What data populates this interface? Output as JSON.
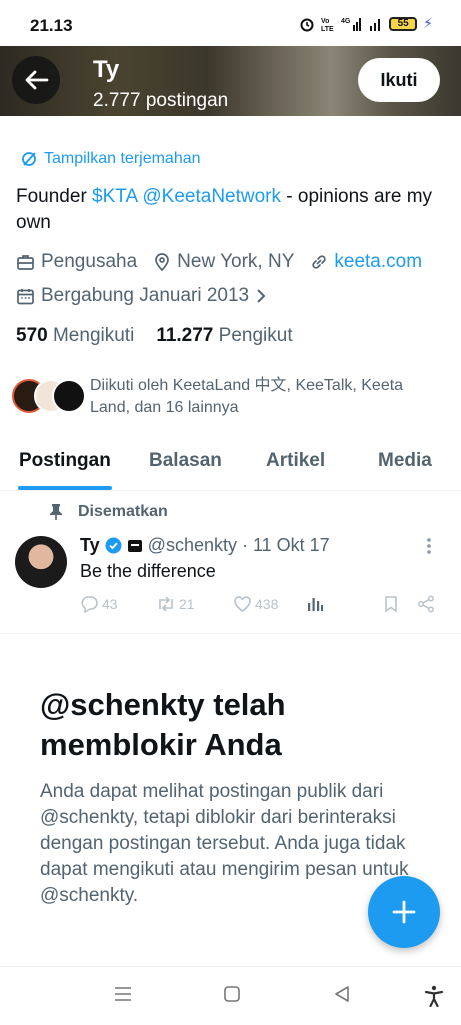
{
  "status_bar": {
    "time": "21.13",
    "battery": "55"
  },
  "header": {
    "name": "Ty",
    "post_count": "2.777 postingan",
    "follow_label": "Ikuti"
  },
  "profile": {
    "translate_label": "Tampilkan terjemahan",
    "bio_prefix": "Founder ",
    "bio_link1": "$KTA",
    "bio_link2": "@KeetaNetwork",
    "bio_suffix": " - opinions are my own",
    "occupation": "Pengusaha",
    "location": "New York, NY",
    "website": "keeta.com",
    "joined": "Bergabung Januari 2013",
    "following_count": "570",
    "following_label": "Mengikuti",
    "followers_count": "11.277",
    "followers_label": "Pengikut",
    "followed_by": "Diikuti oleh KeetaLand 中文, KeeTalk, Keeta Land, dan 16 lainnya"
  },
  "tabs": [
    {
      "label": "Postingan"
    },
    {
      "label": "Balasan"
    },
    {
      "label": "Artikel"
    },
    {
      "label": "Media"
    }
  ],
  "pinned_tweet": {
    "pinned_label": "Disematkan",
    "author_name": "Ty",
    "handle": "@schenkty",
    "date": "· 11 Okt 17",
    "text": "Be the difference",
    "replies": "43",
    "retweets": "21",
    "likes": "438"
  },
  "blocked": {
    "title": "@schenkty telah memblokir Anda",
    "body": "Anda dapat melihat postingan publik dari @schenkty, tetapi diblokir dari berinteraksi dengan postingan tersebut. Anda juga tidak dapat mengikuti atau mengirim pesan untuk @schenkty."
  },
  "colors": {
    "accent": "#1d9bf0",
    "text": "#0f1419",
    "secondary": "#536471"
  }
}
